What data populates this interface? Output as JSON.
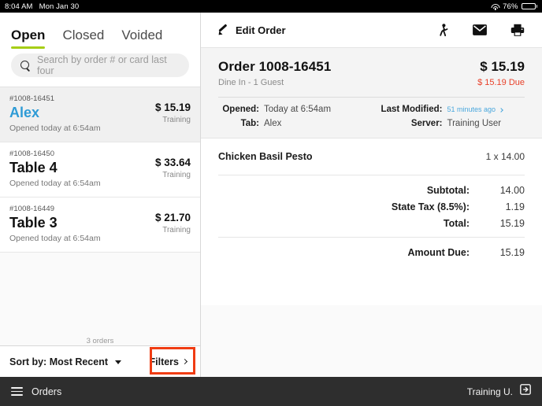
{
  "statusbar": {
    "time": "8:04 AM",
    "date": "Mon Jan 30",
    "wifi_icon": "wifi-icon",
    "battery_percent": "76%",
    "battery_icon": "battery-icon"
  },
  "left_pane": {
    "tabs": [
      {
        "label": "Open",
        "active": true
      },
      {
        "label": "Closed",
        "active": false
      },
      {
        "label": "Voided",
        "active": false
      }
    ],
    "search": {
      "placeholder": "Search by order # or card last four",
      "value": "",
      "icon": "search-icon"
    },
    "orders": [
      {
        "number": "#1008-16451",
        "name": "Alex",
        "opened": "Opened today at 6:54am",
        "amount": "$ 15.19",
        "tag": "Training",
        "selected": true
      },
      {
        "number": "#1008-16450",
        "name": "Table 4",
        "opened": "Opened today at 6:54am",
        "amount": "$ 33.64",
        "tag": "Training",
        "selected": false
      },
      {
        "number": "#1008-16449",
        "name": "Table 3",
        "opened": "Opened today at 6:54am",
        "amount": "$ 21.70",
        "tag": "Training",
        "selected": false
      }
    ],
    "footer": {
      "count_label": "3 orders",
      "sort_label": "Sort by: Most Recent",
      "sort_caret_icon": "caret-down-icon",
      "filters_label": "Filters",
      "filters_chevron_icon": "chevron-right-icon"
    },
    "highlight_color": "#f03c13"
  },
  "right_pane": {
    "toolbar": {
      "edit_label": "Edit Order",
      "edit_icon": "pencil-icon",
      "icons": [
        "person-walking-icon",
        "envelope-icon",
        "printer-icon"
      ]
    },
    "header": {
      "title": "Order 1008-16451",
      "subtitle": "Dine In - 1 Guest",
      "amount": "$ 15.19",
      "due": "$ 15.19 Due",
      "due_color": "#e8412a",
      "meta": {
        "opened_label": "Opened:",
        "opened_value": "Today at 6:54am",
        "tab_label": "Tab:",
        "tab_value": "Alex",
        "last_modified_label": "Last Modified:",
        "last_modified_value": "51 minutes ago",
        "last_modified_link_color": "#49a7dd",
        "server_label": "Server:",
        "server_value": "Training User"
      }
    },
    "items": [
      {
        "name": "Chicken Basil Pesto",
        "qty_price": "1 x 14.00"
      }
    ],
    "totals": [
      {
        "label": "Subtotal:",
        "value": "14.00"
      },
      {
        "label": "State Tax (8.5%):",
        "value": "1.19"
      },
      {
        "label": "Total:",
        "value": "15.19"
      }
    ],
    "amount_due": {
      "label": "Amount Due:",
      "value": "15.19"
    }
  },
  "bottom_bar": {
    "menu_icon": "hamburger-menu-icon",
    "section_label": "Orders",
    "user_label": "Training U.",
    "logout_icon": "logout-icon"
  }
}
